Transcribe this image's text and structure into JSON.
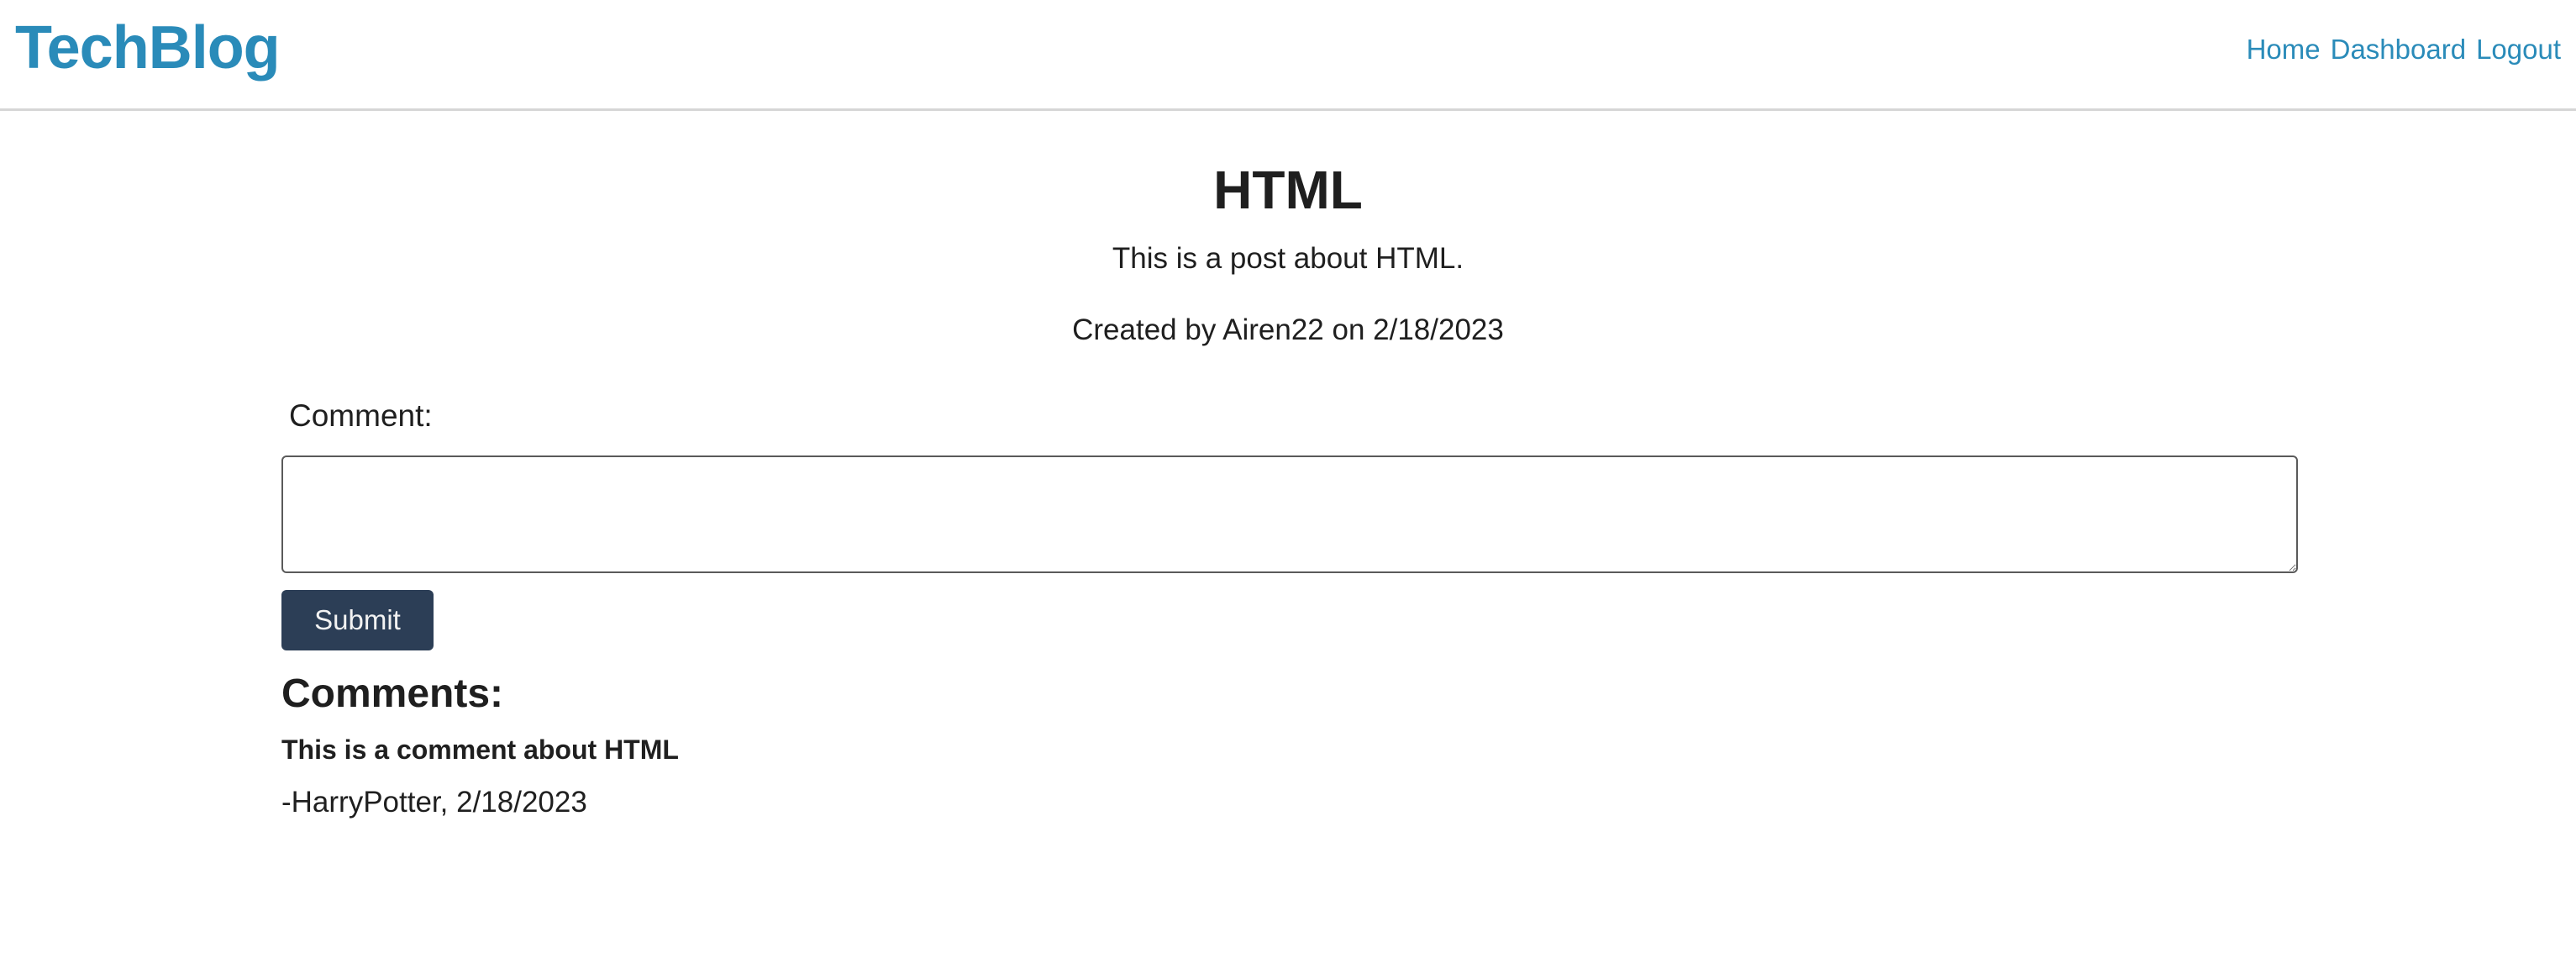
{
  "header": {
    "logo": "TechBlog",
    "nav": {
      "home": "Home",
      "dashboard": "Dashboard",
      "logout": "Logout"
    }
  },
  "post": {
    "title": "HTML",
    "body": "This is a post about HTML.",
    "meta": "Created by Airen22 on 2/18/2023"
  },
  "comment_form": {
    "label": "Comment:",
    "value": "",
    "submit_label": "Submit"
  },
  "comments": {
    "heading": "Comments:",
    "items": [
      {
        "text": "This is a comment about HTML",
        "author_line": "-HarryPotter, 2/18/2023"
      }
    ]
  },
  "colors": {
    "brand": "#2a8bb9",
    "button_bg": "#2c3e56",
    "button_text": "#f2f2f2",
    "text": "#1f1f1f",
    "divider": "#d6d6d6"
  }
}
